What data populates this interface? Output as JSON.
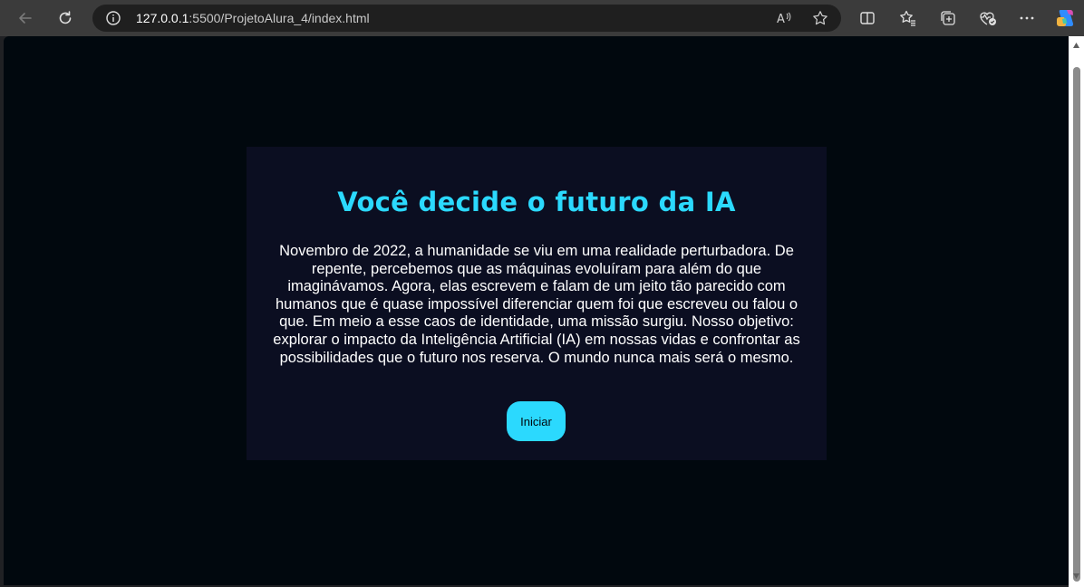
{
  "browser": {
    "url_host": "127.0.0.1",
    "url_rest": ":5500/ProjetoAlura_4/index.html",
    "icons": {
      "back": "back-arrow-icon",
      "refresh": "refresh-icon",
      "site_info": "info-icon",
      "read_aloud": "read-aloud-icon",
      "favorite": "star-icon",
      "split_screen": "split-screen-icon",
      "favorites": "favorites-icon",
      "collections": "collections-icon",
      "browser_essentials": "heart-pulse-icon",
      "menu": "more-icon",
      "copilot": "copilot-icon"
    }
  },
  "page": {
    "title": "Você decide o futuro da IA",
    "intro": "Novembro de 2022, a humanidade se viu em uma realidade perturbadora. De repente, percebemos que as máquinas evoluíram para além do que imaginávamos. Agora, elas escrevem e falam de um jeito tão parecido com humanos que é quase impossível diferenciar quem foi que escreveu ou falou o que. Em meio a esse caos de identidade, uma missão surgiu. Nosso objetivo: explorar o impacto da Inteligência Artificial (IA) em nossas vidas e confrontar as possibilidades que o futuro nos reserva. O mundo nunca mais será o mesmo.",
    "start_button": "Iniciar"
  },
  "colors": {
    "accent": "#2bd9fe",
    "page_background": "#01080e",
    "card_background": "#0b0e21"
  }
}
